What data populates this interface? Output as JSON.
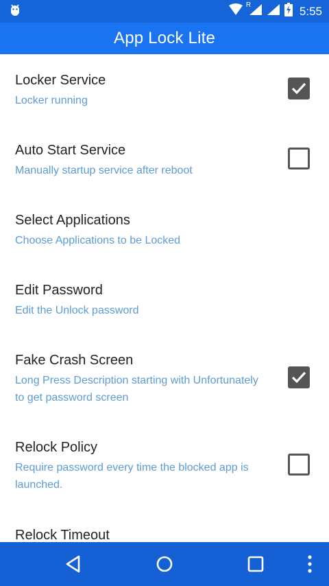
{
  "status_bar": {
    "time": "5:55",
    "icons": [
      "android-debug-icon",
      "wifi-icon",
      "roaming-signal-icon",
      "signal-icon",
      "battery-charging-icon"
    ],
    "roaming_label": "R"
  },
  "app_bar": {
    "title": "App Lock Lite",
    "background": "#1a73f0"
  },
  "settings": [
    {
      "title": "Locker Service",
      "summary": "Locker running",
      "checkbox": "checked"
    },
    {
      "title": "Auto Start Service",
      "summary": "Manually startup service after reboot",
      "checkbox": "unchecked"
    },
    {
      "title": "Select Applications",
      "summary": "Choose Applications to be Locked",
      "checkbox": "none"
    },
    {
      "title": "Edit Password",
      "summary": "Edit the Unlock password",
      "checkbox": "none"
    },
    {
      "title": "Fake Crash Screen",
      "summary": "Long Press Description starting with Unfortunately to get password screen",
      "checkbox": "checked"
    },
    {
      "title": "Relock Policy",
      "summary": "Require password every time the blocked app is launched.",
      "checkbox": "unchecked"
    },
    {
      "title": "Relock Timeout",
      "summary": "",
      "checkbox": "none"
    }
  ],
  "nav_bar": {
    "buttons": [
      "back-icon",
      "home-icon",
      "recents-icon",
      "overflow-menu-icon"
    ],
    "background": "#1560d4"
  },
  "colors": {
    "title_text": "#222222",
    "summary_text": "#5b9bd8",
    "checkbox": "#555555",
    "status_bar": "#1565d8"
  }
}
